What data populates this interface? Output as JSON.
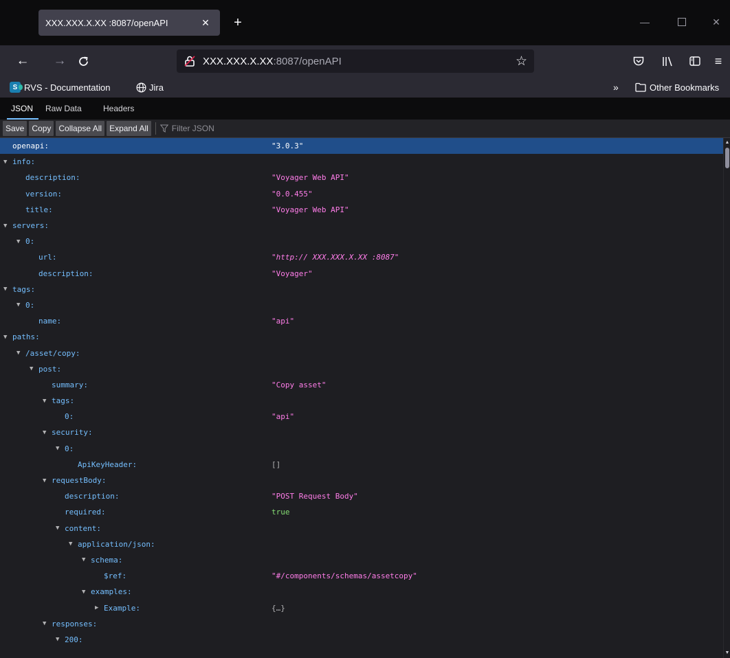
{
  "browser": {
    "tab_title": "XXX.XXX.X.XX :8087/openAPI",
    "url_host": "XXX.XXX.X.XX",
    "url_path": ":8087/openAPI",
    "bookmarks": [
      {
        "label": "RVS - Documentation",
        "icon": "sharepoint-icon"
      },
      {
        "label": "Jira",
        "icon": "globe-icon"
      }
    ],
    "other_bookmarks": "Other Bookmarks",
    "colors": {
      "tabstrip": "#0c0c0d",
      "toolbar": "#2b2a33",
      "urlbar": "#1c1b22"
    }
  },
  "viewer": {
    "tabs": [
      "JSON",
      "Raw Data",
      "Headers"
    ],
    "active_tab": "JSON",
    "toolbar": {
      "save": "Save",
      "copy": "Copy",
      "collapse_all": "Collapse All",
      "expand_all": "Expand All",
      "filter_placeholder": "Filter JSON"
    },
    "colors": {
      "key": "#75bfff",
      "string": "#ff7de9",
      "bool": "#86de74",
      "selected": "#204e8a"
    }
  },
  "tree": {
    "rows": [
      {
        "key": "openapi:",
        "value": "\"3.0.3\"",
        "depth": 0,
        "twisty": "",
        "selected": true
      },
      {
        "key": "info:",
        "value": "",
        "depth": 0,
        "twisty": "open"
      },
      {
        "key": "description:",
        "value": "\"Voyager Web API\"",
        "depth": 1,
        "twisty": ""
      },
      {
        "key": "version:",
        "value": "\"0.0.455\"",
        "depth": 1,
        "twisty": ""
      },
      {
        "key": "title:",
        "value": "\"Voyager Web API\"",
        "depth": 1,
        "twisty": ""
      },
      {
        "key": "servers:",
        "value": "",
        "depth": 0,
        "twisty": "open"
      },
      {
        "key": "0:",
        "value": "",
        "depth": 1,
        "twisty": "open"
      },
      {
        "key": "url:",
        "value": "\"http:// XXX.XXX.X.XX :8087\"",
        "depth": 2,
        "twisty": "",
        "kind": "italic"
      },
      {
        "key": "description:",
        "value": "\"Voyager\"",
        "depth": 2,
        "twisty": ""
      },
      {
        "key": "tags:",
        "value": "",
        "depth": 0,
        "twisty": "open"
      },
      {
        "key": "0:",
        "value": "",
        "depth": 1,
        "twisty": "open"
      },
      {
        "key": "name:",
        "value": "\"api\"",
        "depth": 2,
        "twisty": ""
      },
      {
        "key": "paths:",
        "value": "",
        "depth": 0,
        "twisty": "open"
      },
      {
        "key": "/asset/copy:",
        "value": "",
        "depth": 1,
        "twisty": "open"
      },
      {
        "key": "post:",
        "value": "",
        "depth": 2,
        "twisty": "open"
      },
      {
        "key": "summary:",
        "value": "\"Copy asset\"",
        "depth": 3,
        "twisty": ""
      },
      {
        "key": "tags:",
        "value": "",
        "depth": 3,
        "twisty": "open"
      },
      {
        "key": "0:",
        "value": "\"api\"",
        "depth": 4,
        "twisty": ""
      },
      {
        "key": "security:",
        "value": "",
        "depth": 3,
        "twisty": "open"
      },
      {
        "key": "0:",
        "value": "",
        "depth": 4,
        "twisty": "open"
      },
      {
        "key": "ApiKeyHeader:",
        "value": "[]",
        "depth": 5,
        "twisty": "",
        "kind": "obj"
      },
      {
        "key": "requestBody:",
        "value": "",
        "depth": 3,
        "twisty": "open"
      },
      {
        "key": "description:",
        "value": "\"POST Request Body\"",
        "depth": 4,
        "twisty": ""
      },
      {
        "key": "required:",
        "value": "true",
        "depth": 4,
        "twisty": "",
        "kind": "bool"
      },
      {
        "key": "content:",
        "value": "",
        "depth": 4,
        "twisty": "open"
      },
      {
        "key": "application/json:",
        "value": "",
        "depth": 5,
        "twisty": "open"
      },
      {
        "key": "schema:",
        "value": "",
        "depth": 6,
        "twisty": "open"
      },
      {
        "key": "$ref:",
        "value": "\"#/components/schemas/assetcopy\"",
        "depth": 7,
        "twisty": ""
      },
      {
        "key": "examples:",
        "value": "",
        "depth": 6,
        "twisty": "open"
      },
      {
        "key": "Example:",
        "value": "{…}",
        "depth": 7,
        "twisty": "closed",
        "kind": "obj"
      },
      {
        "key": "responses:",
        "value": "",
        "depth": 3,
        "twisty": "open"
      },
      {
        "key": "200:",
        "value": "",
        "depth": 4,
        "twisty": "open"
      }
    ]
  }
}
